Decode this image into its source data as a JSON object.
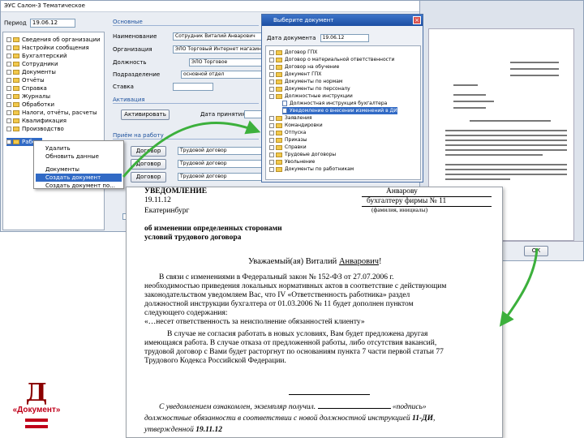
{
  "app": {
    "title": "ЭУС Салон-3 Тематическое",
    "date_label": "Период",
    "date_value": "19.06.12"
  },
  "tree": {
    "items": [
      {
        "label": "Сведения об организации"
      },
      {
        "label": "Настройки сообщения"
      },
      {
        "label": "Бухгалтерский"
      },
      {
        "label": "Сотрудники"
      },
      {
        "label": "Документы"
      },
      {
        "label": "Отчёты"
      },
      {
        "label": "Справка"
      },
      {
        "label": "Журналы"
      },
      {
        "label": "Обработки"
      },
      {
        "label": "Налоги, отчёты, расчеты"
      },
      {
        "label": "Квалификация"
      },
      {
        "label": "Производство"
      },
      {
        "label": "Работа"
      }
    ]
  },
  "context_menu": {
    "items": [
      {
        "label": "Удалить"
      },
      {
        "label": "Обновить данные"
      },
      {
        "label": "Документы"
      },
      {
        "label": "Создать документ"
      },
      {
        "label": "Создать документ по..."
      }
    ]
  },
  "form": {
    "section_main": "Основные",
    "name_label": "Наименование",
    "name_value": "Сотрудник Виталий Анварович",
    "org_label": "Организация",
    "org_value": "ЭЛО Торговый Интернет магазин",
    "post_label": "Должность",
    "post_value": "ЭЛО Торговое",
    "dept_label": "Подразделение",
    "dept_value": "основной отдел",
    "rate_label": "Ставка",
    "section_active": "Активация",
    "activate_button": "Активировать",
    "date_label": "Дата принятия",
    "section_work": "Приём на работу",
    "work_buttons": [
      "Договор",
      "Договор",
      "Договор"
    ],
    "work_fields": [
      "Трудовой договор",
      "Трудовой договор",
      "Трудовой договор"
    ]
  },
  "print_dialog": {
    "title": "Выберите документ",
    "close_label": "×",
    "doc_label": "Дата документа",
    "doc_value": "19.06.12",
    "items": [
      {
        "label": "Договор ГПХ"
      },
      {
        "label": "Договор о материальной ответственности"
      },
      {
        "label": "Договор на обучение"
      },
      {
        "label": "Документ ГПХ"
      },
      {
        "label": "Документы по нормам"
      },
      {
        "label": "Документы по персоналу"
      },
      {
        "label": "Должностные инструкции"
      },
      {
        "label": "Должностная инструкция бухгалтера"
      },
      {
        "label": "Уведомление о внесении изменений в ДИ"
      },
      {
        "label": "Заявления"
      },
      {
        "label": "Командировки"
      },
      {
        "label": "Отпуска"
      },
      {
        "label": "Приказы"
      },
      {
        "label": "Справки"
      },
      {
        "label": "Трудовые договоры"
      },
      {
        "label": "Увольнение"
      },
      {
        "label": "Документы по работникам"
      }
    ]
  },
  "preview": {
    "ok_label": "ОК"
  },
  "document": {
    "title": "УВЕДОМЛЕНИЕ",
    "date": "19.11.12",
    "place": "Екатеринбург",
    "addressee_name": "Анварову",
    "addressee_org": "бухгалтеру фирмы № 11",
    "addressee_note": "(фамилия, инициалы)",
    "subject_1": "об изменении определенных сторонами",
    "subject_2": "условий трудового договора",
    "greeting_prefix": "Уважаемый(ая) Виталий ",
    "greeting_name": "Анварович",
    "greeting_suffix": "!",
    "body_lines": [
      "В связи с изменениями в Федеральный закон № 152-ФЗ от 27.07.2006 г.",
      "необходимостью приведения локальных нормативных актов в соответствие с действующим",
      "законодательством уведомляем Вас, что IV «Ответственность работника» раздел",
      "должностной инструкции бухгалтера от 01.03.2006 № 11 будет дополнен пунктом",
      "следующего содержания:",
      "«…несет ответственность за неисполнение обязанностей клиенту»"
    ],
    "body2_lines": [
      "В случае не согласия работать в новых условиях, Вам будет предложена другая",
      "имеющаяся работа. В случае отказа от предложенной работы, либо отсутствия вакансий,",
      "трудовой договор с Вами будет расторгнут по основаниям пункта 7 части первой статьи 77",
      "Трудового Кодекса Российской Федерации."
    ],
    "ack_prefix": "С уведомлением ознакомлен, экземпляр получил.",
    "ack_suffix": "«подпись»",
    "ack_line2_prefix": "должностные обязанности в соответствии с новой должностной инструкцией ",
    "ack_line2_num": "11-ДИ",
    "ack_line3_prefix": "утвержденной ",
    "ack_line3_date": "19.11.12"
  },
  "logo": {
    "letter": "Д",
    "word": "«Документ»"
  },
  "colors": {
    "arrow": "#3cb03c",
    "selection": "#316ac5",
    "logo_red": "#c0001a"
  }
}
